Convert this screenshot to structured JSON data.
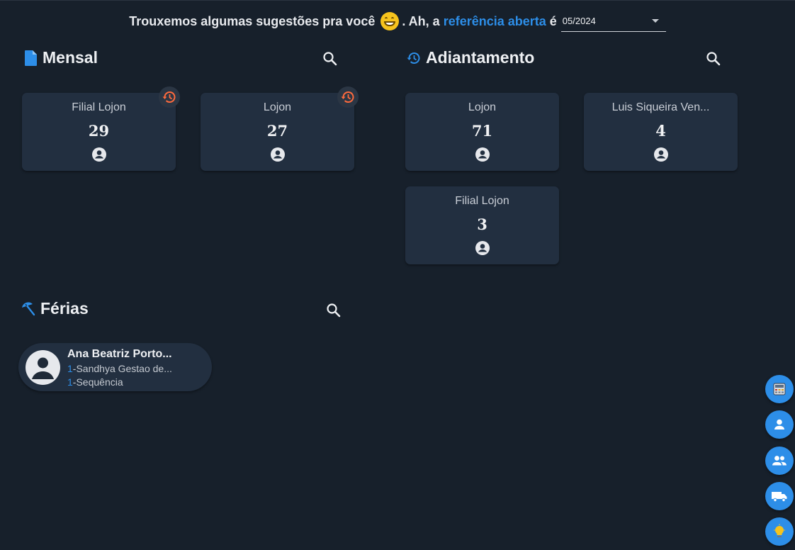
{
  "header": {
    "text_before": "Trouxemos algumas sugestões pra você",
    "text_middle": ". Ah, a",
    "link_text": "referência aberta",
    "text_after": "é",
    "reference_value": "05/2024"
  },
  "mensal": {
    "title": "Mensal",
    "cards": [
      {
        "name": "Filial Lojon",
        "count": "29"
      },
      {
        "name": "Lojon",
        "count": "27"
      }
    ]
  },
  "adiantamento": {
    "title": "Adiantamento",
    "cards": [
      {
        "name": "Lojon",
        "count": "71"
      },
      {
        "name": "Luis Siqueira Ven...",
        "count": "4"
      },
      {
        "name": "Filial Lojon",
        "count": "3"
      }
    ]
  },
  "ferias": {
    "title": "Férias",
    "items": [
      {
        "name": "Ana Beatriz Porto...",
        "line1_num": "1",
        "line1_text": "-Sandhya Gestao de...",
        "line2_num": "1",
        "line2_text": "-Sequência"
      }
    ]
  },
  "colors": {
    "accent": "#2d8ee8",
    "history": "#ff6a3d",
    "card_bg": "#222f40",
    "page_bg": "#17202b"
  },
  "fab_icons": [
    "calculator-icon",
    "person-icon",
    "group-icon",
    "truck-icon",
    "lightbulb-icon"
  ]
}
